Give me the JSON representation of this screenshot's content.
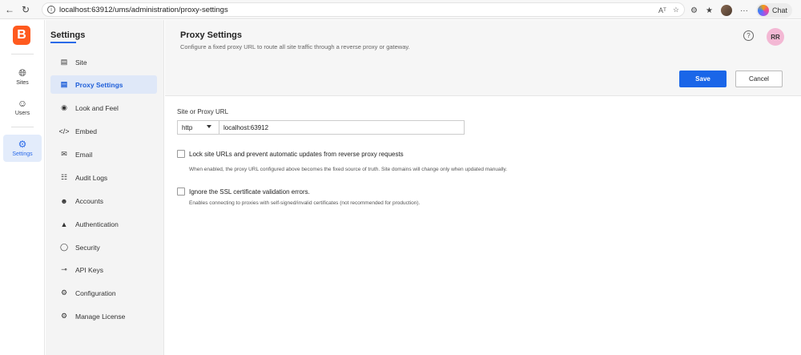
{
  "browser": {
    "url": "localhost:63912/ums/administration/proxy-settings",
    "chat_label": "Chat"
  },
  "rail": {
    "logo": "B",
    "items": [
      {
        "label": "Sites",
        "icon": "globe-icon"
      },
      {
        "label": "Users",
        "icon": "users-icon"
      },
      {
        "label": "Settings",
        "icon": "gear-icon"
      }
    ]
  },
  "menu": {
    "title": "Settings",
    "items": [
      {
        "label": "Site",
        "icon": "site-icon"
      },
      {
        "label": "Proxy Settings",
        "icon": "proxy-icon",
        "active": true
      },
      {
        "label": "Look and Feel",
        "icon": "palette-icon"
      },
      {
        "label": "Embed",
        "icon": "code-icon"
      },
      {
        "label": "Email",
        "icon": "mail-icon"
      },
      {
        "label": "Audit Logs",
        "icon": "audit-icon"
      },
      {
        "label": "Accounts",
        "icon": "accounts-icon"
      },
      {
        "label": "Authentication",
        "icon": "lock-icon"
      },
      {
        "label": "Security",
        "icon": "shield-icon"
      },
      {
        "label": "API Keys",
        "icon": "key-icon"
      },
      {
        "label": "Configuration",
        "icon": "config-icon"
      },
      {
        "label": "Manage License",
        "icon": "license-icon"
      }
    ]
  },
  "header": {
    "title": "Proxy Settings",
    "subtitle": "Configure a fixed proxy URL to route all site traffic through a reverse proxy or gateway.",
    "avatar": "RR",
    "save_label": "Save",
    "cancel_label": "Cancel"
  },
  "form": {
    "field_label": "Site or Proxy URL",
    "protocol": "http",
    "url_value": "localhost:63912",
    "lock": {
      "label": "Lock site URLs and prevent automatic updates from reverse proxy requests",
      "description": "When enabled, the proxy URL configured above becomes the fixed source of truth. Site domains will change only when updated manually."
    },
    "ssl": {
      "label": "Ignore the SSL certificate validation errors.",
      "description": "Enables connecting to proxies with self-signed/invalid certificates (not recommended for production)."
    }
  },
  "colors": {
    "accent": "#1a66e8",
    "logo": "#ff5a1f",
    "active_bg": "#dfe8f8"
  }
}
